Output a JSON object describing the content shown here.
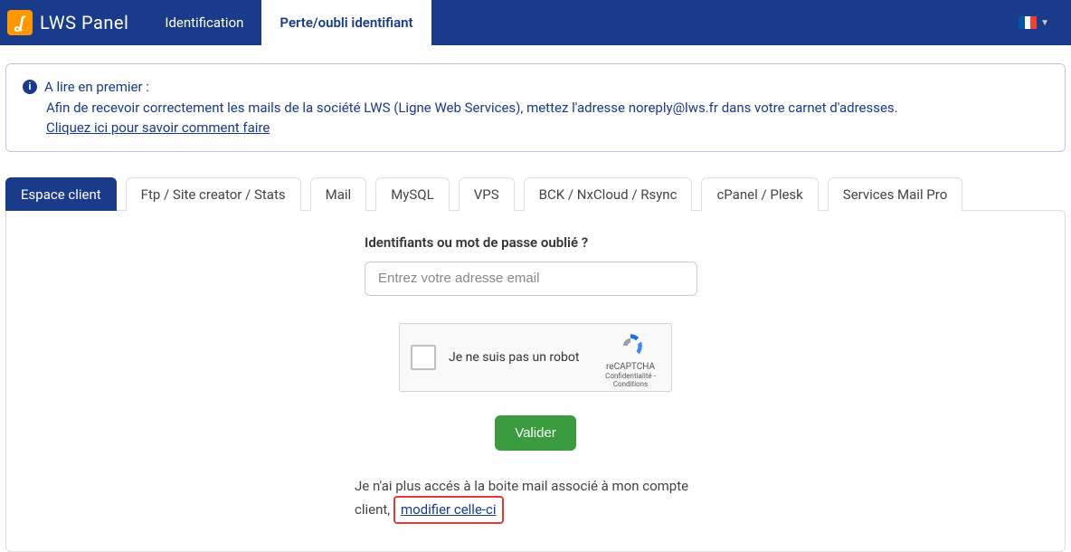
{
  "header": {
    "logo_text": "LWS Panel",
    "tabs": [
      {
        "label": "Identification",
        "active": false
      },
      {
        "label": "Perte/oubli identifiant",
        "active": true
      }
    ]
  },
  "info": {
    "title": "A lire en premier :",
    "body": "Afin de recevoir correctement les mails de la société LWS (Ligne Web Services), mettez l'adresse noreply@lws.fr dans votre carnet d'adresses.",
    "link": "Cliquez ici pour savoir comment faire"
  },
  "service_tabs": [
    "Espace client",
    "Ftp / Site creator / Stats",
    "Mail",
    "MySQL",
    "VPS",
    "BCK / NxCloud / Rsync",
    "cPanel / Plesk",
    "Services Mail Pro"
  ],
  "form": {
    "label": "Identifiants ou mot de passe oublié ?",
    "placeholder": "Entrez votre adresse email",
    "captcha_label": "Je ne suis pas un robot",
    "captcha_brand": "reCAPTCHA",
    "captcha_links": "Confidentialité - Conditions",
    "submit": "Valider",
    "no_access_text": "Je n'ai plus accés à la boite mail associé à mon compte client, ",
    "modify_link": "modifier celle-ci"
  }
}
